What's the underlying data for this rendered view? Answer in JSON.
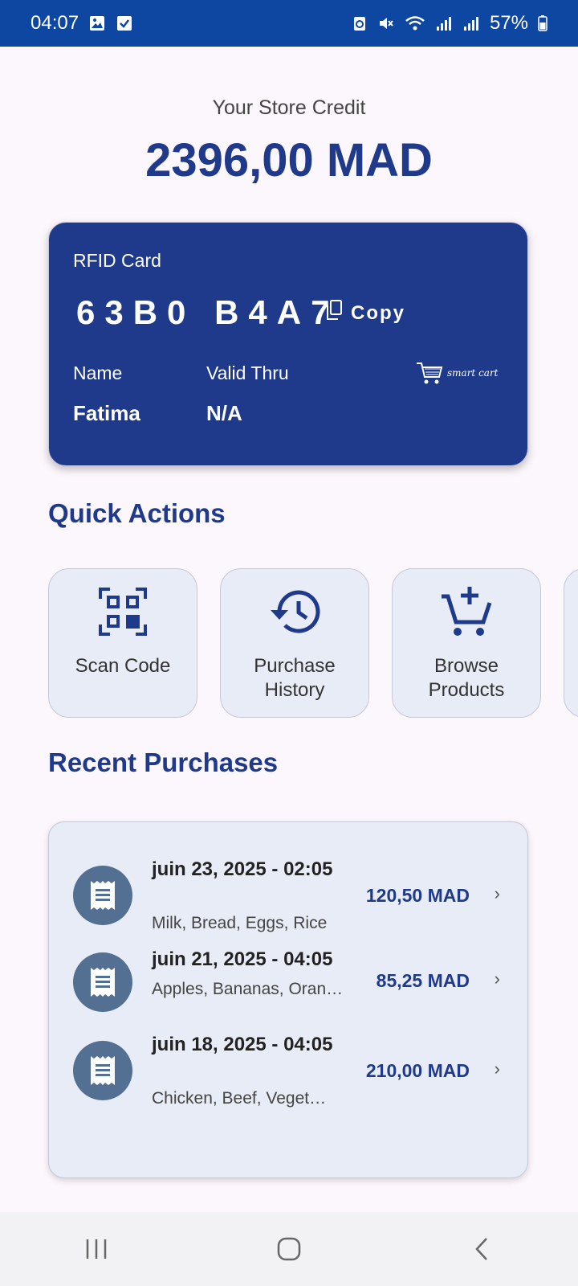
{
  "status_bar": {
    "time": "04:07",
    "battery": "57%"
  },
  "balance": {
    "label": "Your Store Credit",
    "amount": "2396,00 MAD"
  },
  "rfid_card": {
    "title": "RFID Card",
    "number": "63B0 B4A7",
    "copy_label": "Copy",
    "name_label": "Name",
    "name_value": "Fatima",
    "valid_label": "Valid Thru",
    "valid_value": "N/A",
    "logo_text": "smart cart"
  },
  "quick_actions": {
    "title": "Quick Actions",
    "items": [
      {
        "label": "Scan Code",
        "icon": "qr-scan-icon"
      },
      {
        "label": "Purchase History",
        "icon": "history-icon"
      },
      {
        "label": "Browse Products",
        "icon": "cart-plus-icon"
      }
    ]
  },
  "recent_purchases": {
    "title": "Recent Purchases",
    "items": [
      {
        "date": "juin 23, 2025 - 02:05",
        "items": "Milk, Bread, Eggs, Rice",
        "amount": "120,50 MAD"
      },
      {
        "date": "juin 21, 2025 - 04:05",
        "items": "Apples, Bananas, Oran…",
        "amount": "85,25 MAD"
      },
      {
        "date": "juin 18, 2025 - 04:05",
        "items": "Chicken, Beef, Veget…",
        "amount": "210,00 MAD"
      }
    ]
  },
  "colors": {
    "primary": "#1f3a8a",
    "status_bar": "#0d47a1",
    "tile_bg": "#e8ecf6",
    "receipt_circle": "#536f92"
  }
}
